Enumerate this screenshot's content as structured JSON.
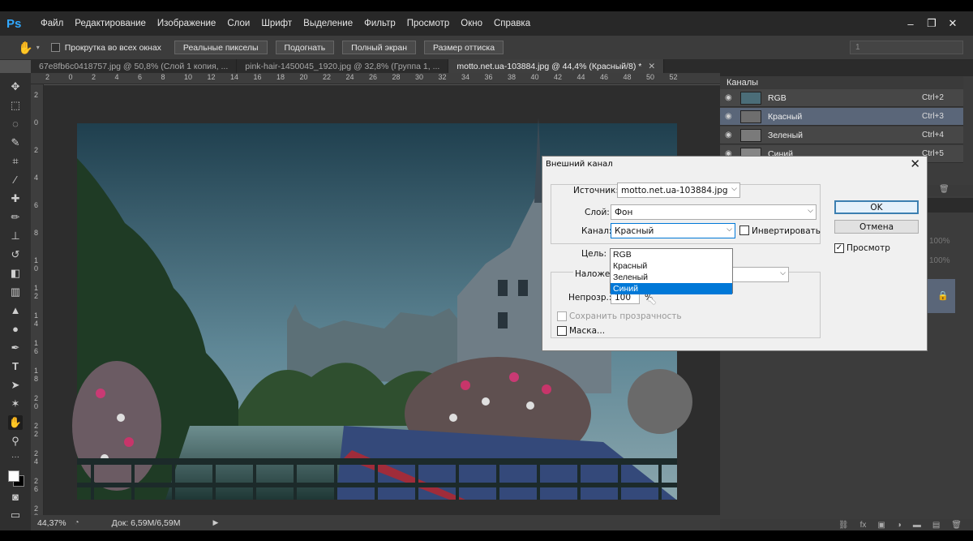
{
  "app": {
    "logo": "Ps"
  },
  "menu": [
    "Файл",
    "Редактирование",
    "Изображение",
    "Слои",
    "Шрифт",
    "Выделение",
    "Фильтр",
    "Просмотр",
    "Окно",
    "Справка"
  ],
  "window_controls": {
    "minimize": "‒",
    "restore": "❐",
    "close": "✕"
  },
  "options": {
    "scroll_all_label": "Прокрутка во всех окнах",
    "buttons": [
      "Реальные пикселы",
      "Подогнать",
      "Полный экран",
      "Размер оттиска"
    ],
    "workspace_value": "1"
  },
  "tabs": [
    {
      "label": "67e8fb6c0418757.jpg @ 50,8% (Слой 1 копия, ...",
      "active": false
    },
    {
      "label": "pink-hair-1450045_1920.jpg @ 32,8% (Группа 1, ...",
      "active": false
    },
    {
      "label": "motto.net.ua-103884.jpg @ 44,4% (Красный/8) *",
      "active": true
    }
  ],
  "ruler_top": [
    "2",
    "0",
    "2",
    "4",
    "6",
    "8",
    "10",
    "12",
    "14",
    "16",
    "18",
    "20",
    "22",
    "24",
    "26",
    "28",
    "30",
    "32",
    "34",
    "36",
    "38",
    "40",
    "42",
    "44",
    "46",
    "48",
    "50",
    "52"
  ],
  "ruler_left": [
    "2",
    "0",
    "2",
    "4",
    "6",
    "8",
    "1 0",
    "1 2",
    "1 4",
    "1 6",
    "1 8",
    "2 0",
    "2 2",
    "2 4",
    "2 6",
    "2 8"
  ],
  "status": {
    "zoom": "44,37%",
    "doc": "Док: 6,59M/6,59M"
  },
  "channels_panel": {
    "title": "Каналы",
    "rows": [
      {
        "name": "RGB",
        "shortcut": "Ctrl+2",
        "selected": false
      },
      {
        "name": "Красный",
        "shortcut": "Ctrl+3",
        "selected": true
      },
      {
        "name": "Зеленый",
        "shortcut": "Ctrl+4",
        "selected": false
      },
      {
        "name": "Синий",
        "shortcut": "Ctrl+5",
        "selected": false
      }
    ],
    "faded_percent_1": "100%",
    "faded_percent_2": "100%"
  },
  "dialog": {
    "title": "Внешний канал",
    "source_label": "Источник:",
    "source_value": "motto.net.ua-103884.jpg",
    "layer_label": "Слой:",
    "layer_value": "Фон",
    "channel_label": "Канал:",
    "channel_value": "Красный",
    "invert_label": "Инвертировать",
    "target_label": "Цель:",
    "blend_label": "Наложен",
    "opacity_label": "Непрозр.:",
    "opacity_value": "100",
    "opacity_unit": "%",
    "preserve_label": "Сохранить прозрачность",
    "mask_label": "Маска...",
    "ok_label": "OK",
    "cancel_label": "Отмена",
    "preview_label": "Просмотр",
    "channel_options": [
      "RGB",
      "Красный",
      "Зеленый",
      "Синий"
    ],
    "highlighted_option": "Синий"
  },
  "colors": {
    "accent": "#0078d7",
    "selected_channel": "#5a6679",
    "ps_blue": "#31a8ff"
  }
}
